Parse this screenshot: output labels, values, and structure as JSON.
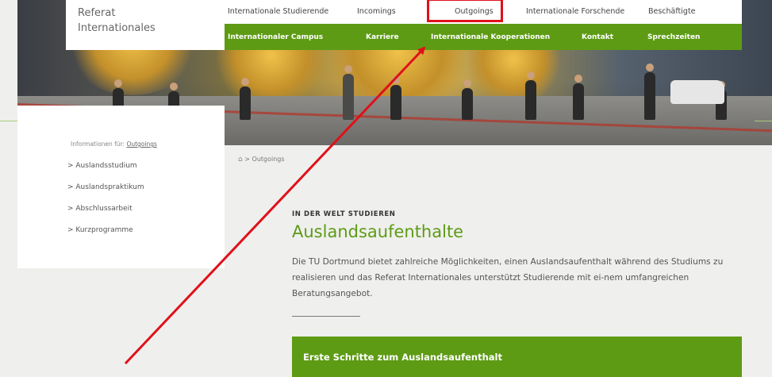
{
  "header": {
    "logo_line1": "Referat",
    "logo_line2": "Internationales"
  },
  "nav": {
    "top": [
      "Internationale Studierende",
      "Incomings",
      "Outgoings",
      "Internationale Forschende",
      "Beschäftigte"
    ],
    "bottom": [
      "Internationaler Campus",
      "Karriere",
      "Internationale Kooperationen",
      "Kontakt",
      "Sprechzeiten"
    ],
    "highlighted": "Outgoings"
  },
  "sidebar": {
    "info_prefix": "Informationen für:",
    "info_link": "Outgoings",
    "items": [
      "> Auslandsstudium",
      "> Auslandspraktikum",
      "> Abschlussarbeit",
      "> Kurzprogramme"
    ]
  },
  "breadcrumb": {
    "home_icon": "home-icon",
    "separator": ">",
    "current": "Outgoings"
  },
  "main": {
    "kicker": "IN DER WELT STUDIEREN",
    "title": "Auslandsaufenthalte",
    "intro": "Die TU Dortmund bietet zahlreiche Möglichkeiten, einen Auslandsaufenthalt während des Studiums zu realisieren und das Referat Internationales unterstützt Studierende mit ei-nem umfangreichen Beratungsangebot.",
    "accordion_label": "Erste Schritte zum Auslandsaufenthalt"
  },
  "colors": {
    "brand_green": "#5d9b14",
    "annotation_red": "#e0101a",
    "background": "#efefed"
  }
}
